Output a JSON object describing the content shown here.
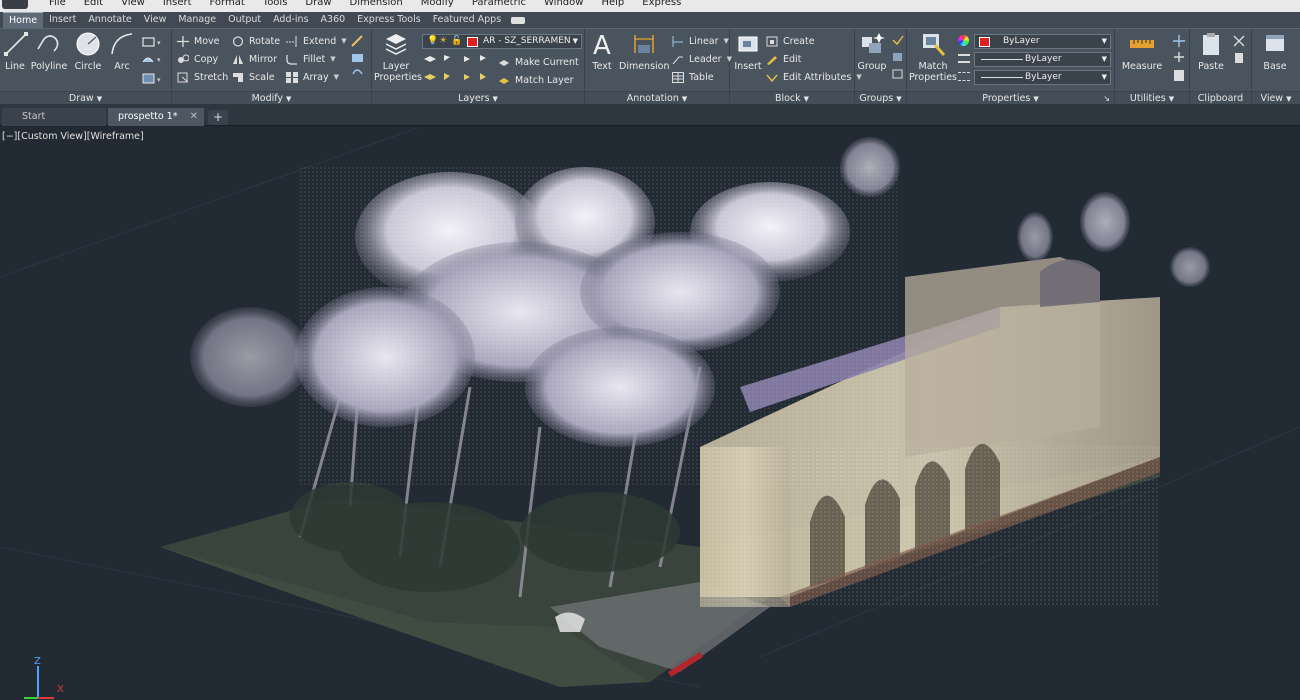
{
  "menubar": {
    "items": [
      "File",
      "Edit",
      "View",
      "Insert",
      "Format",
      "Tools",
      "Draw",
      "Dimension",
      "Modify",
      "Parametric",
      "Window",
      "Help",
      "Express"
    ]
  },
  "ribbon_tabs": {
    "items": [
      "Home",
      "Insert",
      "Annotate",
      "View",
      "Manage",
      "Output",
      "Add-ins",
      "A360",
      "Express Tools",
      "Featured Apps"
    ],
    "active": "Home"
  },
  "panels": {
    "draw": {
      "title": "Draw",
      "line": "Line",
      "polyline": "Polyline",
      "circle": "Circle",
      "arc": "Arc"
    },
    "modify": {
      "title": "Modify",
      "move": "Move",
      "rotate": "Rotate",
      "extend": "Extend",
      "copy": "Copy",
      "mirror": "Mirror",
      "fillet": "Fillet",
      "stretch": "Stretch",
      "scale": "Scale",
      "array": "Array"
    },
    "layers": {
      "title": "Layers",
      "layer_properties": "Layer Properties",
      "current_layer": "AR - SZ_SERRAMEN",
      "make_current": "Make Current",
      "match_layer": "Match Layer"
    },
    "annotation": {
      "title": "Annotation",
      "text": "Text",
      "dimension": "Dimension",
      "linear": "Linear",
      "leader": "Leader",
      "table": "Table"
    },
    "block": {
      "title": "Block",
      "insert": "Insert",
      "create": "Create",
      "edit": "Edit",
      "edit_attributes": "Edit Attributes"
    },
    "groups": {
      "title": "Groups",
      "group": "Group"
    },
    "properties": {
      "title": "Properties",
      "match_properties": "Match Properties",
      "color": "ByLayer",
      "linetype": "ByLayer",
      "lineweight": "ByLayer",
      "accent_color": "#e02020"
    },
    "utilities": {
      "title": "Utilities",
      "measure": "Measure"
    },
    "clipboard": {
      "title": "Clipboard",
      "paste": "Paste"
    },
    "view": {
      "title": "View",
      "base": "Base"
    }
  },
  "doc_tabs": {
    "start": "Start",
    "active": "prospetto 1*"
  },
  "viewport": {
    "label": "[−][Custom View][Wireframe]",
    "background": "#222a33"
  }
}
